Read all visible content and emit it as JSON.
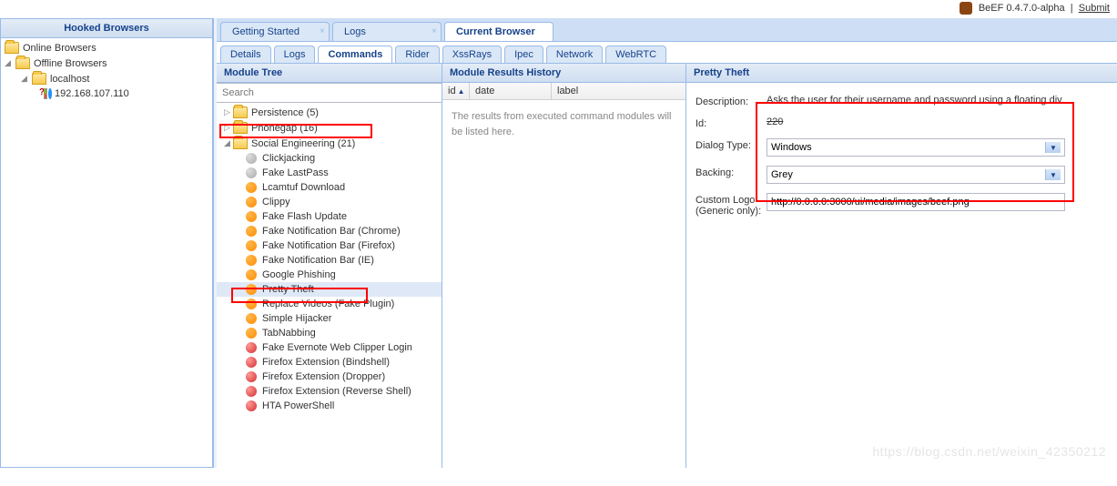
{
  "topbar": {
    "product": "BeEF",
    "version": "0.4.7.0-alpha",
    "sep": "|",
    "submit": "Submit"
  },
  "left": {
    "header": "Hooked Browsers",
    "online": "Online Browsers",
    "offline": "Offline Browsers",
    "host": "localhost",
    "ip": "192.168.107.110"
  },
  "mainTabs": [
    {
      "label": "Getting Started",
      "closable": true
    },
    {
      "label": "Logs",
      "closable": true
    },
    {
      "label": "Current Browser",
      "active": true
    }
  ],
  "subTabs": [
    "Details",
    "Logs",
    "Commands",
    "Rider",
    "XssRays",
    "Ipec",
    "Network",
    "WebRTC"
  ],
  "activeSubTab": "Commands",
  "moduleTree": {
    "header": "Module Tree",
    "searchPlaceholder": "Search",
    "folders": [
      {
        "label": "Persistence (5)"
      },
      {
        "label": "Phonegap (16)"
      },
      {
        "label": "Social Engineering (21)",
        "expanded": true,
        "highlight": true
      }
    ],
    "items": [
      {
        "label": "Clickjacking",
        "color": "grey"
      },
      {
        "label": "Fake LastPass",
        "color": "grey"
      },
      {
        "label": "Lcamtuf Download",
        "color": "orange"
      },
      {
        "label": "Clippy",
        "color": "orange"
      },
      {
        "label": "Fake Flash Update",
        "color": "orange"
      },
      {
        "label": "Fake Notification Bar (Chrome)",
        "color": "orange"
      },
      {
        "label": "Fake Notification Bar (Firefox)",
        "color": "orange"
      },
      {
        "label": "Fake Notification Bar (IE)",
        "color": "orange"
      },
      {
        "label": "Google Phishing",
        "color": "orange"
      },
      {
        "label": "Pretty Theft",
        "color": "orange",
        "selected": true,
        "highlight": true
      },
      {
        "label": "Replace Videos (Fake Plugin)",
        "color": "orange"
      },
      {
        "label": "Simple Hijacker",
        "color": "orange"
      },
      {
        "label": "TabNabbing",
        "color": "orange"
      },
      {
        "label": "Fake Evernote Web Clipper Login",
        "color": "red"
      },
      {
        "label": "Firefox Extension (Bindshell)",
        "color": "red"
      },
      {
        "label": "Firefox Extension (Dropper)",
        "color": "red"
      },
      {
        "label": "Firefox Extension (Reverse Shell)",
        "color": "red"
      },
      {
        "label": "HTA PowerShell",
        "color": "red"
      }
    ]
  },
  "results": {
    "header": "Module Results History",
    "cols": {
      "id": "id",
      "date": "date",
      "label": "label"
    },
    "empty": "The results from executed command modules will be listed here."
  },
  "details": {
    "header": "Pretty Theft",
    "fields": {
      "descLabel": "Description:",
      "desc": "Asks the user for their username and password using a floating div.",
      "idLabel": "Id:",
      "id": "220",
      "dialogLabel": "Dialog Type:",
      "dialog": "Windows",
      "backingLabel": "Backing:",
      "backing": "Grey",
      "logoLabel1": "Custom Logo",
      "logoLabel2": "(Generic only):",
      "logo": "http://0.0.0.0:3000/ui/media/images/beef.png"
    }
  },
  "watermark": "https://blog.csdn.net/weixin_42350212"
}
